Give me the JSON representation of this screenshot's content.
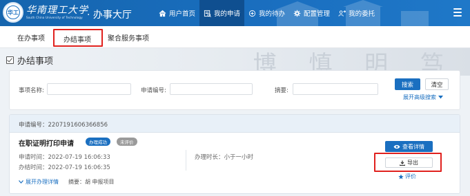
{
  "header": {
    "logo_cn": "华南理工大学",
    "logo_en": "South China University of Technology",
    "logo_seal": "华工",
    "app_title": "· 办事大厅",
    "nav": [
      {
        "label": "用户首页",
        "icon": "home-icon"
      },
      {
        "label": "我的申请",
        "icon": "apply-icon",
        "active": true
      },
      {
        "label": "我的待办",
        "icon": "todo-icon"
      },
      {
        "label": "配置管理",
        "icon": "settings-icon"
      },
      {
        "label": "我的委托",
        "icon": "delegate-icon"
      }
    ],
    "menu_icon": "hamburger-icon"
  },
  "tabs": [
    {
      "label": "在办事项"
    },
    {
      "label": "办结事项",
      "active": true
    },
    {
      "label": "聚合服务事项"
    }
  ],
  "background_chars": "博 慎 明 笃",
  "section": {
    "title": "办结事项"
  },
  "search": {
    "item_name_label": "事项名称:",
    "apply_no_label": "申请编号:",
    "summary_label": "摘要:",
    "item_name_value": "",
    "apply_no_value": "",
    "summary_value": "",
    "search_button": "搜索",
    "clear_button": "清空",
    "advanced_link": "展开高级搜索"
  },
  "result": {
    "apply_no_text": "申请编号：2207191606366856",
    "title": "在职证明打印申请",
    "status_badge": "办理成功",
    "rating_badge": "未评价",
    "apply_time": "申请时间：2022-07-19 16:06:33",
    "finish_time": "办结时间：2022-07-19 16:06:35",
    "duration": "办理时长：小于一小时",
    "expand_link": "展开办理详情",
    "summary": "摘要：胡    申报项目",
    "detail_button": "查看详情",
    "export_button": "导出",
    "rate_link": "评价"
  },
  "colors": {
    "brand_blue": "#1a6fc0",
    "nav_active": "#0f4f90",
    "success_badge": "#1a6fc0",
    "gray_badge": "#9a9a9a",
    "highlight_red": "#e0201d"
  }
}
